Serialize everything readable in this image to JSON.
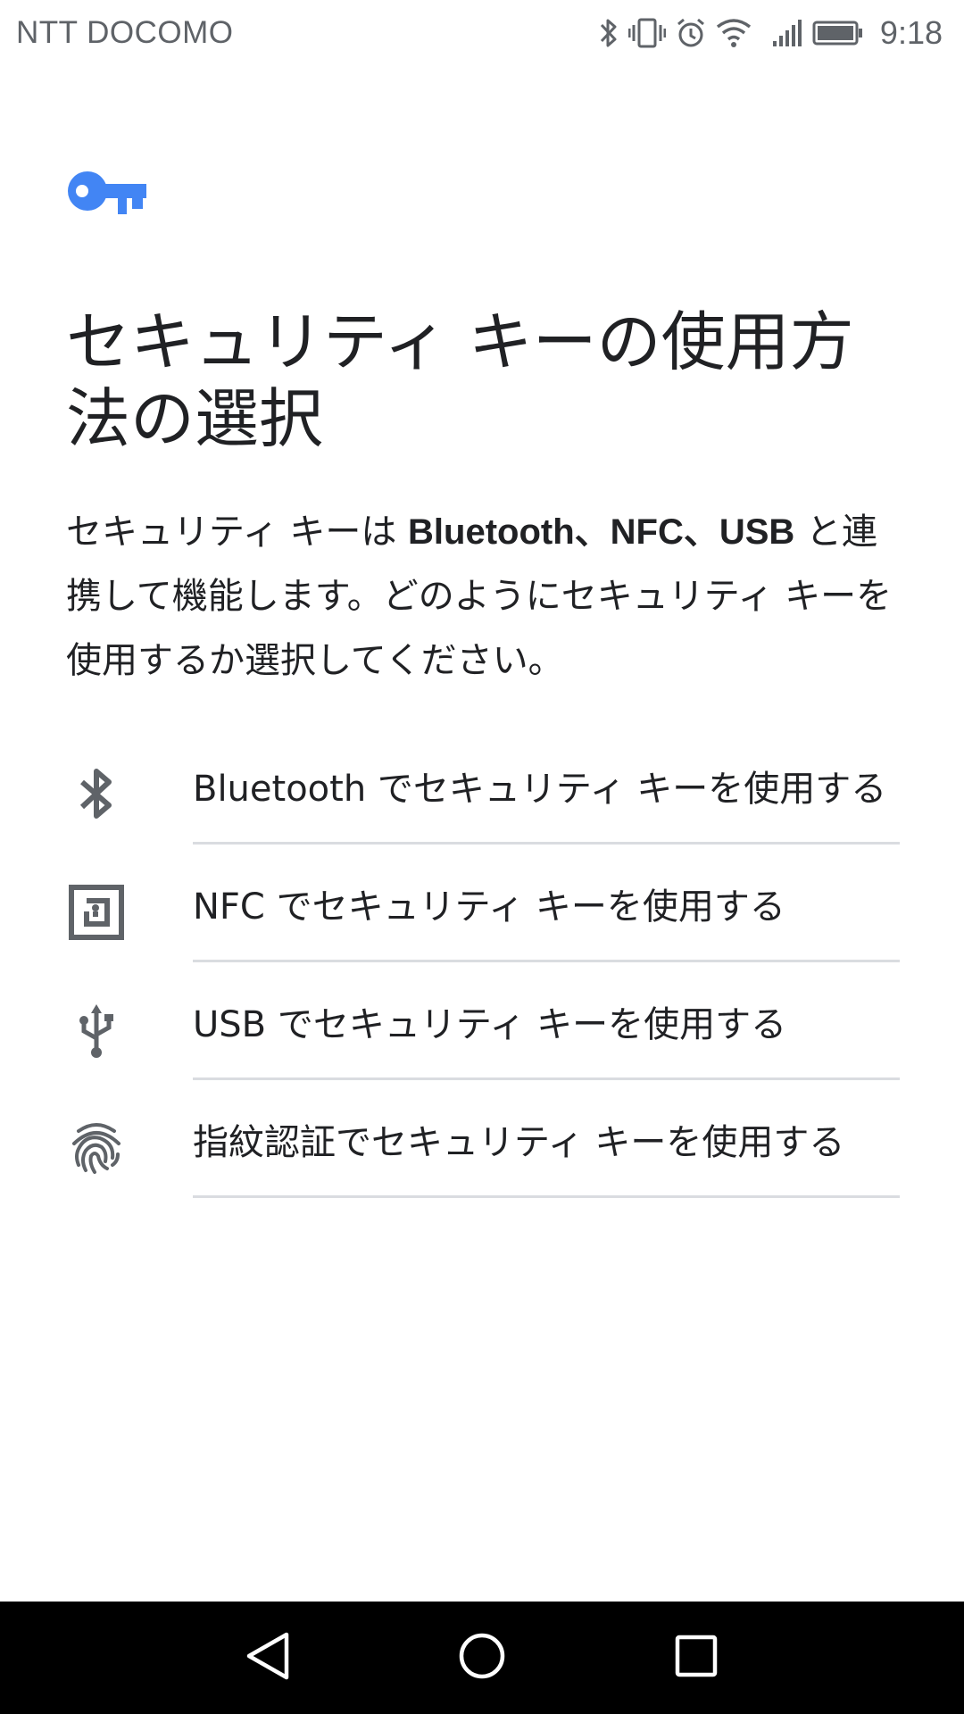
{
  "status_bar": {
    "carrier": "NTT DOCOMO",
    "time": "9:18",
    "icons": [
      "bluetooth-icon",
      "vibrate-icon",
      "alarm-icon",
      "wifi-icon",
      "signal-icon",
      "battery-icon"
    ]
  },
  "header": {
    "icon": "key-icon",
    "accent_color": "#4285f4",
    "title": "セキュリティ キーの使用方法の選択"
  },
  "description": {
    "part1": "セキュリティ キーは ",
    "bold": "Bluetooth、NFC、USB",
    "part2": " と連携して機能します。どのようにセキュリティ キーを使用するか選択してください。"
  },
  "options": [
    {
      "icon": "bluetooth-icon",
      "label": "Bluetooth でセキュリティ キーを使用する"
    },
    {
      "icon": "nfc-icon",
      "label": "NFC でセキュリティ キーを使用する"
    },
    {
      "icon": "usb-icon",
      "label": "USB でセキュリティ キーを使用する"
    },
    {
      "icon": "fingerprint-icon",
      "label": "指紋認証でセキュリティ キーを使用する"
    }
  ],
  "nav_bar": {
    "buttons": [
      "back-icon",
      "home-icon",
      "recents-icon"
    ]
  }
}
